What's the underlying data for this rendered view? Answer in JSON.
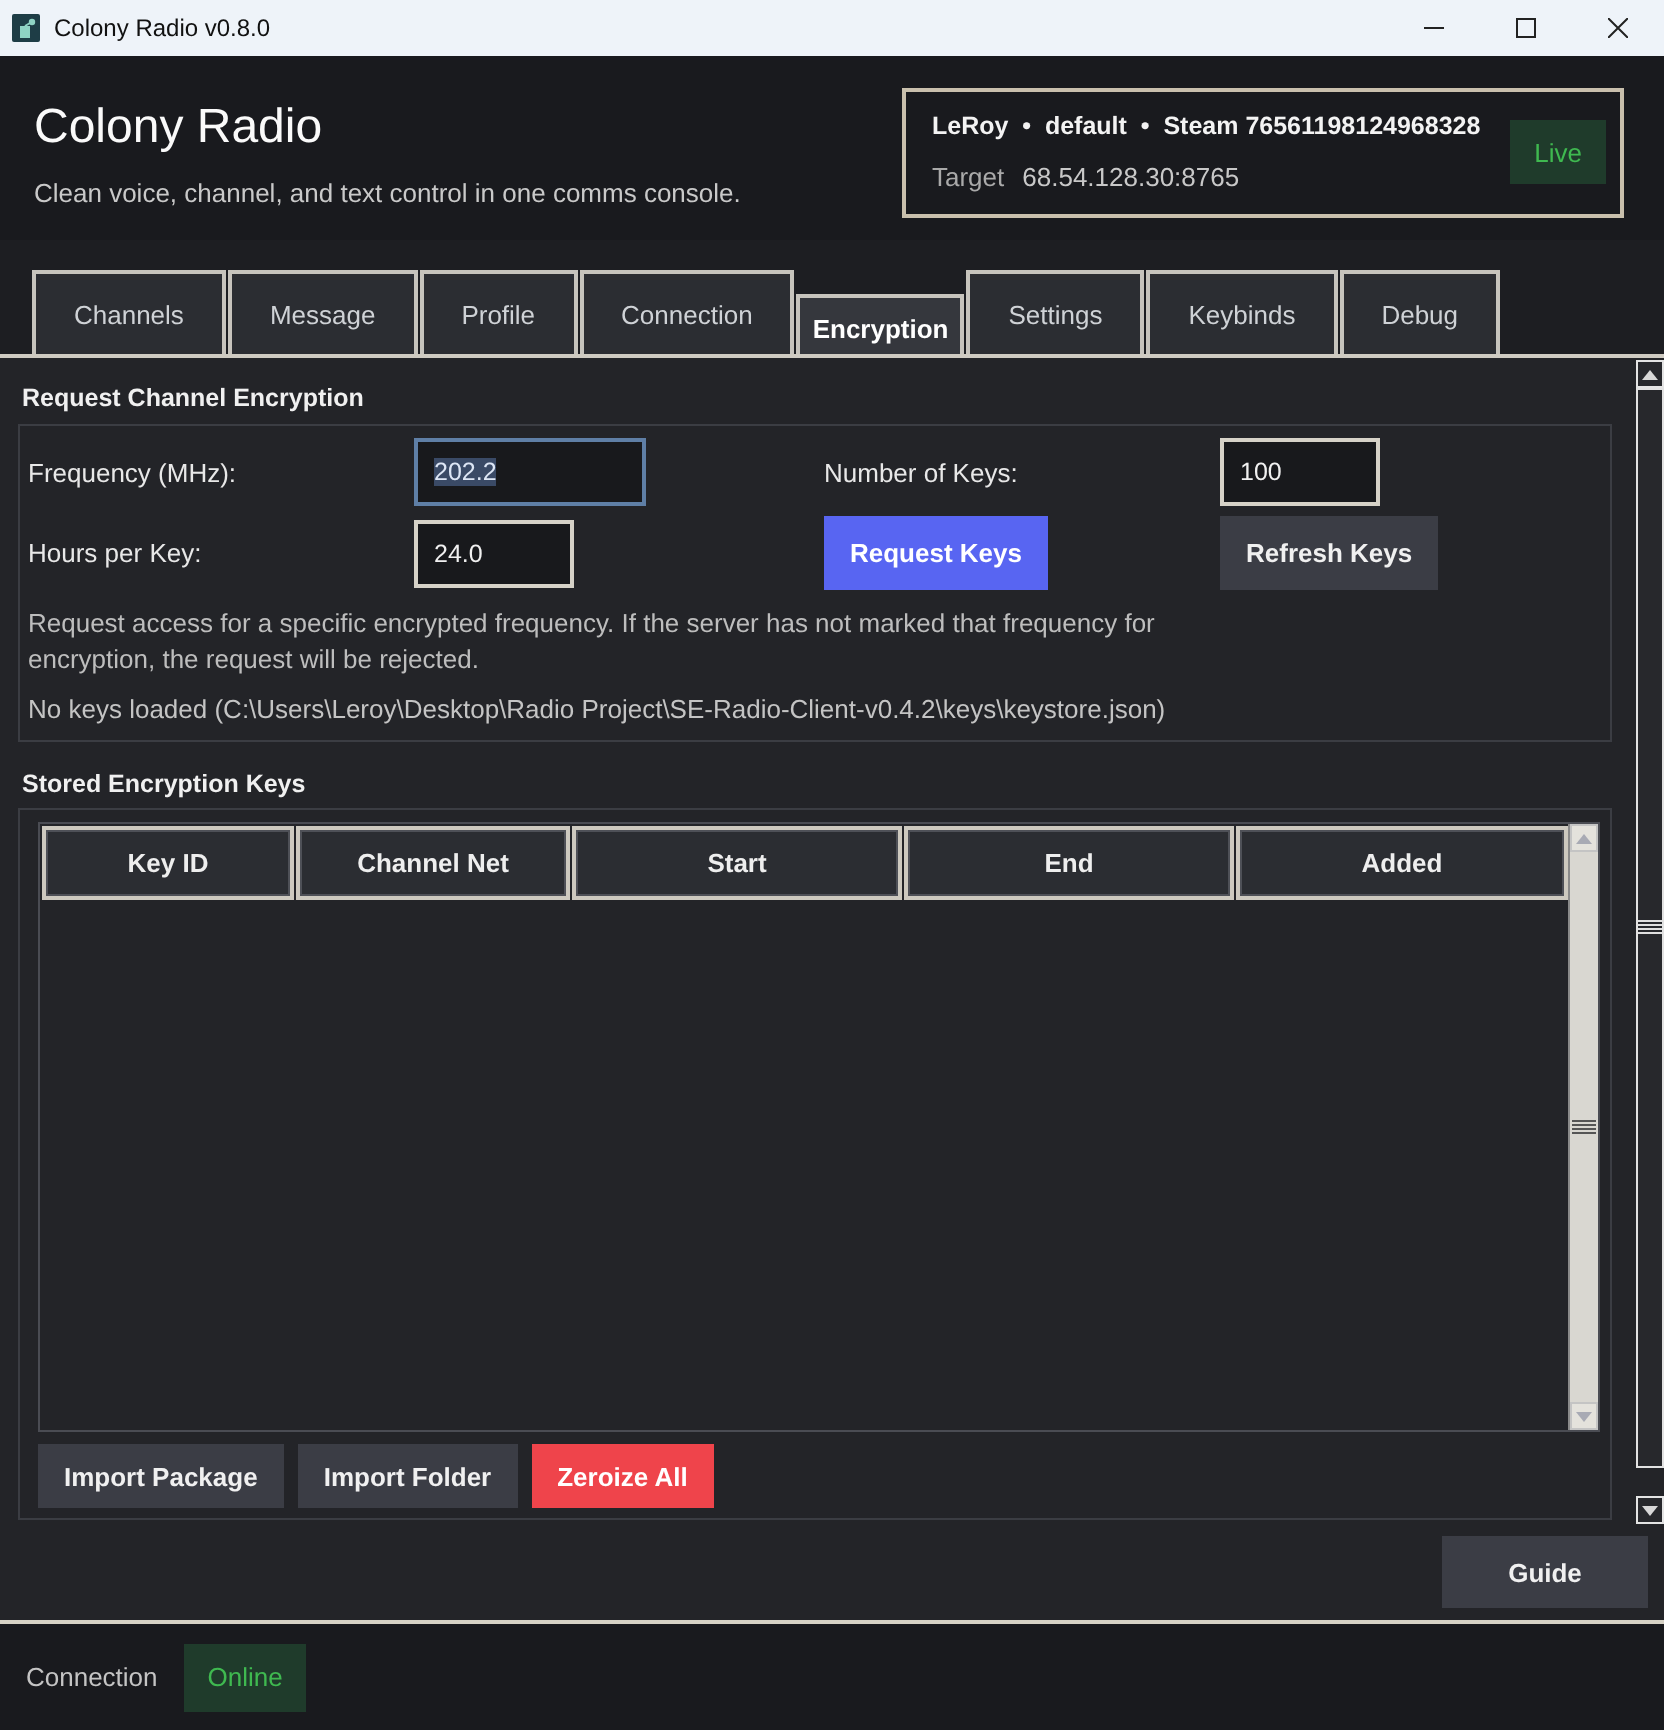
{
  "window": {
    "title": "Colony Radio v0.8.0"
  },
  "header": {
    "title": "Colony Radio",
    "subtitle": "Clean voice, channel, and text control in one comms console.",
    "session": {
      "identity": "LeRoy  •  default  •  Steam 76561198124968328",
      "target_label": "Target",
      "target": "68.54.128.30:8765",
      "status": {
        "label": "Live",
        "kind": "ok"
      }
    }
  },
  "tabs": [
    {
      "label": "Channels",
      "selected": false
    },
    {
      "label": "Message",
      "selected": false
    },
    {
      "label": "Profile",
      "selected": false
    },
    {
      "label": "Connection",
      "selected": false
    },
    {
      "label": "Encryption",
      "selected": true
    },
    {
      "label": "Settings",
      "selected": false
    },
    {
      "label": "Keybinds",
      "selected": false
    },
    {
      "label": "Debug",
      "selected": false
    }
  ],
  "request": {
    "title": "Request Channel Encryption",
    "frequency": {
      "label": "Frequency (MHz):",
      "value": "202.2",
      "focused": true
    },
    "hours_per_key": {
      "label": "Hours per Key:",
      "value": "24.0",
      "focused": false
    },
    "number_of_keys": {
      "label": "Number of Keys:",
      "value": "100",
      "focused": false
    },
    "buttons": [
      {
        "label": "Request Keys",
        "kind": "primary"
      },
      {
        "label": "Refresh Keys",
        "kind": "secondary"
      }
    ],
    "help_text": "Request access for a specific encrypted frequency. If the server has not marked that frequency for encryption, the request will be rejected.",
    "status_text": "No keys loaded (C:\\Users\\Leroy\\Desktop\\Radio Project\\SE-Radio-Client-v0.4.2\\keys\\keystore.json)"
  },
  "stored": {
    "title": "Stored Encryption Keys",
    "table": {
      "columns": [
        "Key ID",
        "Channel Net",
        "Start",
        "End",
        "Added"
      ]
    },
    "buttons": [
      {
        "label": "Import Package",
        "kind": "secondary"
      },
      {
        "label": "Import Folder",
        "kind": "secondary"
      },
      {
        "label": "Zeroize All",
        "kind": "danger"
      }
    ]
  },
  "guide_button": {
    "label": "Guide"
  },
  "status_bar": {
    "label": "Connection",
    "status": {
      "label": "Online",
      "kind": "ok"
    }
  }
}
